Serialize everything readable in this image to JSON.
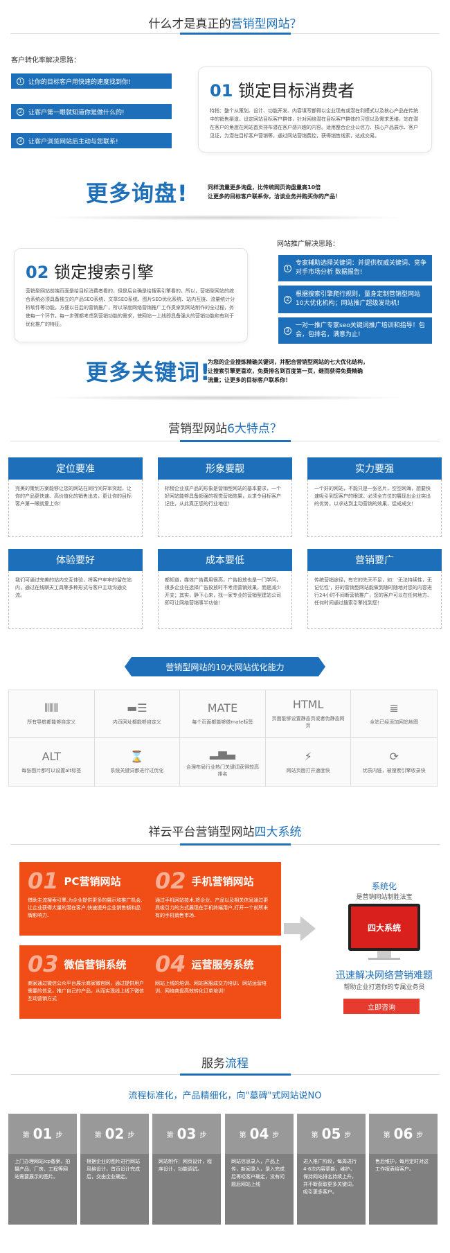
{
  "s1": {
    "title_pre": "什么才是真正的",
    "title_hl": "营销型网站？",
    "conv_label": "客户转化率解决思路：",
    "bars": [
      {
        "n": "1",
        "t": "让你的目标客户用快速的速度找到你!"
      },
      {
        "n": "2",
        "t": "让客户第一眼就知道你是做什么的!"
      },
      {
        "n": "3",
        "t": "让客户浏览网站后主动与您联系!"
      }
    ],
    "card_num": "01",
    "card_title": "锁定目标消费者",
    "card_text": "特指：整个从策划、设计、功能开发、内容填写都得以企业现有或潜在利模式以及核心产品在传统中的销售渠道，设定网站目标客户群体，针对网络潜在目标客户群体的习惯以及需求思维，站在潜在客户的角度在网站首页排布潜在客户感兴趣的内容。适用整合企业公信力、核心产品展示、客户见证，为潜在目标客户营销等，通过网站营销费控，获得销售线索，达成交易。",
    "big": "更多询盘!",
    "big_desc": "同样流量更多询盘，比传统网页询盘量高10倍\n让更多的目标客户联系你，洽谈业务并购买你的产品！"
  },
  "s2": {
    "card_num": "02",
    "card_title": "锁定搜索引擎",
    "card_text": "营销型网站前端页面是给目标消费者看的，但是后台确是给搜索引擎看的，所以，营销型网站的综合系统必须具备独立的产品SEO系统、文章SEO系统、图片SEO优化系统、站内互链、流量统计分析软件等功能，方便以日后的营销推广，所以深度网络营销推广工作贯穿到网站制作的全过程，务使每一个环节，每一步骤都考虑到营销功能的需求，使网站一上线即具备强大的营销功能和有利于优化推广的特征。",
    "promo_label": "网站推广解决思路：",
    "bars": [
      {
        "n": "1",
        "t": "专家辅助选择关键词：并提供权威关键词、竞争对手市场分析 数据报告!"
      },
      {
        "n": "2",
        "t": "根据搜索引擎爬行规则，量身定制营销型网站10大优化机构；网站推广超级发动机!"
      },
      {
        "n": "3",
        "t": "一对一推广专家seo关键词推广培训和指导！包会，包排名，满意为止!"
      }
    ],
    "big": "更多关键词!",
    "big_desc": "为您的企业搜炼精确关键词，并配合营销型网站的七大优化结构，\n让搜索引擎更喜欢，免费排名到百度第一页，继而获得免费精确\n流量；让更多的目标客户联系你！"
  },
  "s3": {
    "title_pre": "营销型网站",
    "title_hl": "6大特点？",
    "features": [
      {
        "h": "定位要准",
        "t": "完美的策划方案能够让您的网站在同行间异军突起，让你的产品更快速、高价值化的销售出去，更让你的目标客户第一眼就爱上你！"
      },
      {
        "h": "形象要靓",
        "t": "标榜企业或产品的形象是营销型网站的基本要求，一个好网站能够具备超强的视觉营销效果，以求令目标客户记住，从此真正您的行业地位！"
      },
      {
        "h": "实力要强",
        "t": "一个好的网站，不能只是一张名片，空空网海，想要快速吸引到您客户的眼球，必须全方位的展现出企业突出的优势，以求达到主动营销的效果，促成成交！"
      },
      {
        "h": "体验要好",
        "t": "我们可通过完美的站内交互体验，将客户牢牢的留在站内，通过在线聊天工具等多种形式与客户主动沟通交流。"
      },
      {
        "h": "成本要低",
        "t": "都知道，媒体广告费用很高，广告投放也是一门学问，很多企业在选择广告投放时不考虑营销效果，而是减少开支；其实，静下心来，找一家专业的营销型建站公司即可让网络营销事半功倍！"
      },
      {
        "h": "营销要广",
        "t": "传统营销途径，有它的先天不足，如：'无法持续性，无记忆性'，好的营销型网站能做到随时随地对您的内容进行24小时不间断营销推广，您的客户可以在任何地方、任何时间通过搜索引擎找到您！"
      }
    ]
  },
  "s4": {
    "ribbon": "营销型网站的10大网站优化能力",
    "cells": [
      {
        "icon": "sliders-icon",
        "g": "⫴",
        "top": "",
        "t": "所有导航都能够自定义"
      },
      {
        "icon": "list-icon",
        "g": "☰",
        "top": "",
        "t": "内页网址都能够自定义"
      },
      {
        "icon": "mate-icon",
        "g": "",
        "top": "MATE",
        "t": "每个页面都能够做mate标签"
      },
      {
        "icon": "html-icon",
        "g": "",
        "top": "HTML",
        "t": "页面能够设置静态页或者伪静态网页"
      },
      {
        "icon": "sitemap-icon",
        "g": "≣",
        "top": "",
        "t": "全站已经添加网站地图"
      },
      {
        "icon": "alt-icon",
        "g": "",
        "top": "ALT",
        "t": "每张图片都可以设置alt标签"
      },
      {
        "icon": "hourglass-icon",
        "g": "⌛",
        "top": "",
        "t": "系统关键词都进行过优化"
      },
      {
        "icon": "podium-icon",
        "g": "▂▅▃",
        "top": "",
        "t": "合理布局行业热门关键词获得较高排名"
      },
      {
        "icon": "lightning-icon",
        "g": "⚡",
        "top": "",
        "t": "网站页面打开速度快"
      },
      {
        "icon": "refresh-icon",
        "g": "⟳",
        "top": "",
        "t": "优质内链，被搜索引擎收录快"
      }
    ]
  },
  "s5": {
    "title_pre": "祥云平台营销型网站",
    "title_hl": "四大系统",
    "systems": [
      {
        "n": "01",
        "s": "PC营销网站",
        "t": "借助主流搜索引擎,为企业提供更多的展示和推广机会,让企业获得大量的潜在客户,快速提升企业销售额和品牌影响力."
      },
      {
        "n": "02",
        "s": "手机营销网站",
        "t": "通过手机网站技术,将企业、产品以及相关信息通过更具吸引力的方式展现在手机终端用户,打开一个前所未有的手机销售市场."
      },
      {
        "n": "03",
        "s": "微信营销系统",
        "t": "商家通过微信公众平台展示商家微官网，通过提供用户需要的信息，推广自己的产品，从而实现线上线下微信互动营销方式"
      },
      {
        "n": "04",
        "s": "运营服务系统",
        "t": "网站上线的培训、网站客服成交力培训、网站运营培训、网络商盘高效转化订单培训！"
      }
    ],
    "r_title": "系统化",
    "r_sub": "是营销网站制胜法宝",
    "screen": "四大系统",
    "r_big": "迅速解决网络营销难题",
    "r_small": "帮助企业打造你的专属业务员",
    "btn": "立即咨询"
  },
  "s6": {
    "title_pre": "服务",
    "title_hl": "流程",
    "slogan": "流程标准化，产品精细化，向\"墓碑\"式网站说NO",
    "step_word": "步",
    "steps": [
      {
        "pre": "第",
        "n": "01",
        "t": "上门办理网站icp备案，拍摄产品、厂房、工程等网站需要展示的图片。"
      },
      {
        "pre": "第",
        "n": "02",
        "t": "根据企业的图片进行网站风格设计，首页设计完成后，交由企业确定。"
      },
      {
        "pre": "第",
        "n": "03",
        "t": "网站制作：网页设计，程序设计，功能调试。"
      },
      {
        "pre": "第",
        "n": "04",
        "t": "网站信息录入，产品上传，新闻录入，录入完成后再经客户确定，没有问题后网站上线"
      },
      {
        "pre": "第",
        "n": "05",
        "t": "进入推广阶段，每周进行4-6次内容更新，维护，保持网站排名持续上升，并不断获取更多关键词，吸引更多客户。"
      },
      {
        "pre": "第",
        "n": "06",
        "t": "售后维护，每月定时对这工作报表给客户。"
      }
    ]
  },
  "colors": {
    "blue": "#1e6fb9",
    "orange": "#f04e16",
    "grey": "#999999"
  }
}
